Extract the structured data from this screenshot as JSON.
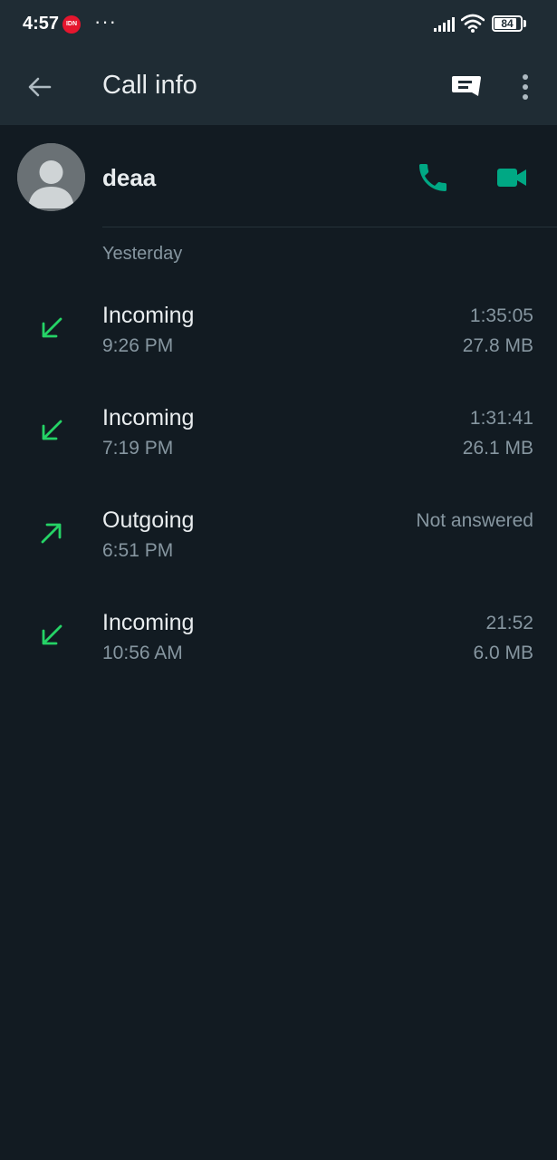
{
  "status_bar": {
    "time": "4:57",
    "notification_badge": "IDN",
    "more_dots": "···",
    "battery_level": "84",
    "battery_percent": 84
  },
  "header": {
    "title": "Call info",
    "back_icon": "arrow-left-icon",
    "message_icon": "message-icon",
    "more_icon": "more-vertical-icon"
  },
  "contact": {
    "name": "deaa",
    "avatar_icon": "default-person-avatar",
    "voice_call_icon": "phone-icon",
    "video_call_icon": "videocam-icon"
  },
  "section_label": "Yesterday",
  "calls": [
    {
      "type": "Incoming",
      "time": "9:26 PM",
      "duration": "1:35:05",
      "size": "27.8 MB",
      "direction": "incoming"
    },
    {
      "type": "Incoming",
      "time": "7:19 PM",
      "duration": "1:31:41",
      "size": "26.1 MB",
      "direction": "incoming"
    },
    {
      "type": "Outgoing",
      "time": "6:51 PM",
      "duration": "Not answered",
      "size": "",
      "direction": "outgoing"
    },
    {
      "type": "Incoming",
      "time": "10:56 AM",
      "duration": "21:52",
      "size": "6.0 MB",
      "direction": "incoming"
    }
  ],
  "colors": {
    "background": "#121b22",
    "header": "#1f2c34",
    "accent": "#00a884",
    "call_arrow": "#25d366",
    "primary_text": "#e9edef",
    "secondary_text": "#8696a0"
  }
}
